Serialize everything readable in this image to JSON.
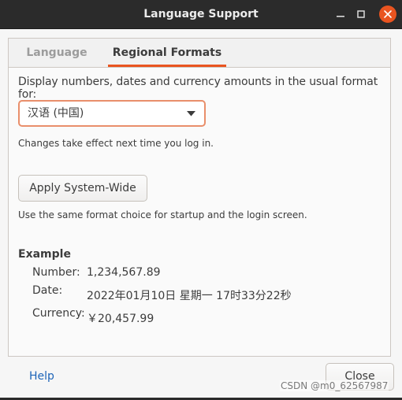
{
  "window": {
    "title": "Language Support",
    "controls": [
      "minimize-icon",
      "maximize-icon",
      "close-icon"
    ],
    "accent_color": "#e95420"
  },
  "tabs": [
    {
      "label": "Language",
      "active": false
    },
    {
      "label": "Regional Formats",
      "active": true
    }
  ],
  "regional": {
    "description": "Display numbers, dates and currency amounts in the usual format for:",
    "selected_format": "汉语 (中国)",
    "change_note": "Changes take effect next time you log in.",
    "apply_button": "Apply System-Wide",
    "apply_note": "Use the same format choice for startup and the login screen."
  },
  "example": {
    "heading": "Example",
    "number_label": "Number:",
    "number_value": "1,234,567.89",
    "date_label": "Date:",
    "date_value": "2022年01月10日 星期一 17时33分22秒",
    "currency_label": "Currency:",
    "currency_value": "￥20,457.99"
  },
  "footer": {
    "help_label": "Help",
    "close_label": "Close"
  },
  "watermark": "CSDN @m0_62567987"
}
